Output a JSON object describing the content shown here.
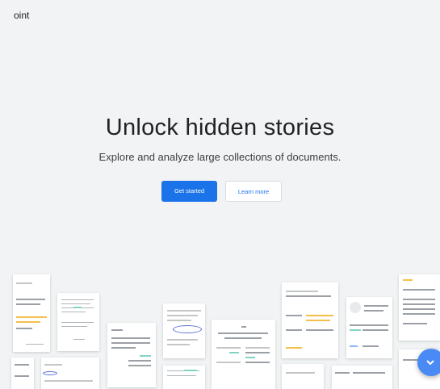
{
  "header": {
    "brand_fragment": "oint"
  },
  "hero": {
    "title": "Unlock hidden stories",
    "subtitle": "Explore and analyze large collections of documents.",
    "primary_button": "Get started",
    "secondary_button": "Learn more"
  },
  "icons": {
    "fab": "chevron-down-icon"
  },
  "colors": {
    "background": "#f1f3f4",
    "accent": "#1a73e8",
    "fab": "#4a8af4",
    "highlight_yellow": "#f3c04a",
    "highlight_green": "#81d4c4"
  }
}
